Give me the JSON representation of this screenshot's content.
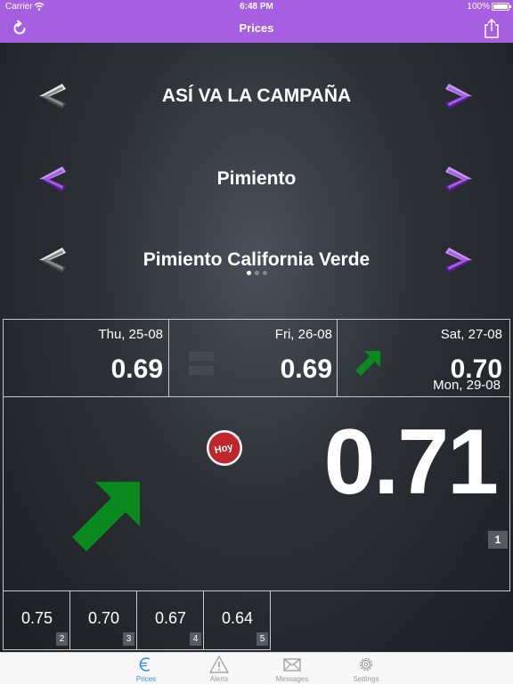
{
  "status_bar": {
    "carrier": "Carrier",
    "time": "6:48 PM",
    "battery": "100%"
  },
  "nav": {
    "title": "Prices",
    "left_icon": "refresh-icon",
    "right_icon": "share-icon"
  },
  "selectors": [
    {
      "label": "ASÍ VA LA CAMPAÑA",
      "left_active": false,
      "right_active": true
    },
    {
      "label": "Pimiento",
      "left_active": true,
      "right_active": true
    },
    {
      "label": "Pimiento California Verde",
      "left_active": false,
      "right_active": true
    }
  ],
  "page_dots": {
    "count": 3,
    "active": 0
  },
  "previous_days": [
    {
      "date": "Thu, 25-08",
      "price": "0.69",
      "trend_icon": ""
    },
    {
      "date": "Fri, 26-08",
      "price": "0.69",
      "trend_icon": "equal-icon"
    },
    {
      "date": "Sat, 27-08",
      "price": "0.70",
      "trend_icon": "arrow-up-right-icon"
    }
  ],
  "today": {
    "badge_text": "Hoy",
    "date": "Mon, 29-08",
    "price": "0.71",
    "rank": "1",
    "trend_icon": "arrow-up-right-icon"
  },
  "upcoming": [
    {
      "price": "0.75",
      "rank": "2"
    },
    {
      "price": "0.70",
      "rank": "3"
    },
    {
      "price": "0.67",
      "rank": "4"
    },
    {
      "price": "0.64",
      "rank": "5"
    }
  ],
  "tabs": [
    {
      "label": "Prices",
      "icon": "euro-icon",
      "active": true
    },
    {
      "label": "Alerts",
      "icon": "warning-icon",
      "active": false
    },
    {
      "label": "Messages",
      "icon": "envelope-icon",
      "active": false
    },
    {
      "label": "Settings",
      "icon": "gear-icon",
      "active": false
    }
  ],
  "colors": {
    "accent": "#a55fe0",
    "trend_up": "#0a8a1e",
    "tab_active": "#2b8cf0",
    "badge_red": "#c0272d"
  }
}
